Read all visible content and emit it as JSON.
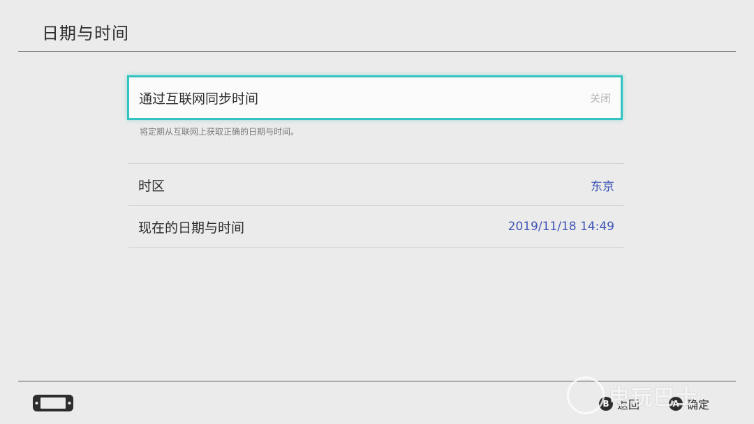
{
  "header": {
    "title": "日期与时间"
  },
  "sync": {
    "label": "通过互联网同步时间",
    "value": "关闭",
    "description": "将定期从互联网上获取正确的日期与时间。"
  },
  "rows": [
    {
      "label": "时区",
      "value": "东京"
    },
    {
      "label": "现在的日期与时间",
      "value": "2019/11/18 14:49"
    }
  ],
  "footer": {
    "console_icon": "switch-console-icon",
    "back": {
      "glyph": "B",
      "label": "返回"
    },
    "confirm": {
      "glyph": "A",
      "label": "确定"
    }
  },
  "watermark": {
    "text": "电玩巴士"
  },
  "colors": {
    "accent": "#34c3c0",
    "value_text": "#3f55b8",
    "background": "#ebebeb"
  }
}
